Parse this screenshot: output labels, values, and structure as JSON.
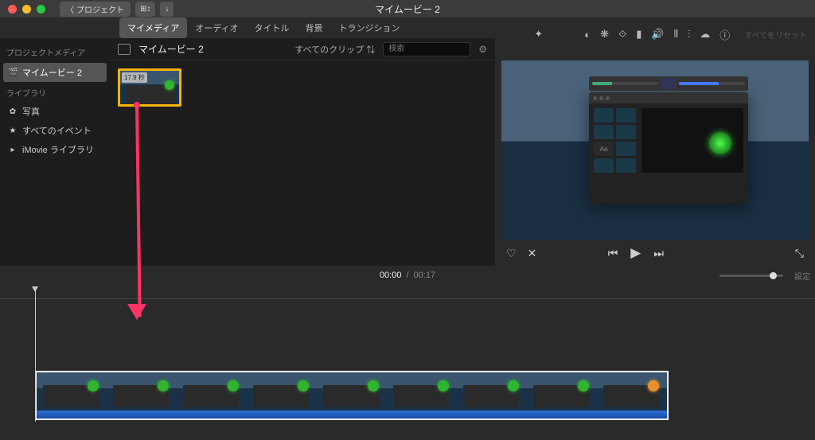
{
  "window": {
    "title": "マイムービー 2"
  },
  "titlebar": {
    "back_label": "プロジェクト",
    "btn2_icon": "⊞↕",
    "btn3_icon": "↓"
  },
  "tabs": {
    "items": [
      "マイメディア",
      "オーディオ",
      "タイトル",
      "背景",
      "トランジション"
    ],
    "selected": 0
  },
  "inspector": {
    "icons": [
      "wand",
      "contrast",
      "palette",
      "crop",
      "video",
      "audio",
      "eq",
      "bars",
      "cloud",
      "info"
    ],
    "reset_label": "すべてをリセット"
  },
  "sidebar": {
    "hdr1": "プロジェクトメディア",
    "project": "マイムービー 2",
    "hdr2": "ライブラリ",
    "items": [
      {
        "icon": "✿",
        "label": "写真"
      },
      {
        "icon": "★",
        "label": "すべてのイベント"
      },
      {
        "icon": "▸",
        "label": "iMovie ライブラリ"
      }
    ]
  },
  "browser": {
    "title": "マイムービー 2",
    "filter_label": "すべてのクリップ",
    "search_placeholder": "検索",
    "clip_duration": "17.9 秒"
  },
  "viewer": {
    "favorite_icon": "♡",
    "reject_icon": "✕",
    "prev_icon": "⏮",
    "play_icon": "▶",
    "next_icon": "⏭",
    "fullscreen_icon": "⤡"
  },
  "time": {
    "current": "00:00",
    "sep": "/",
    "duration": "00:17",
    "settings_label": "設定"
  },
  "timeline": {
    "frame_count": 9
  }
}
